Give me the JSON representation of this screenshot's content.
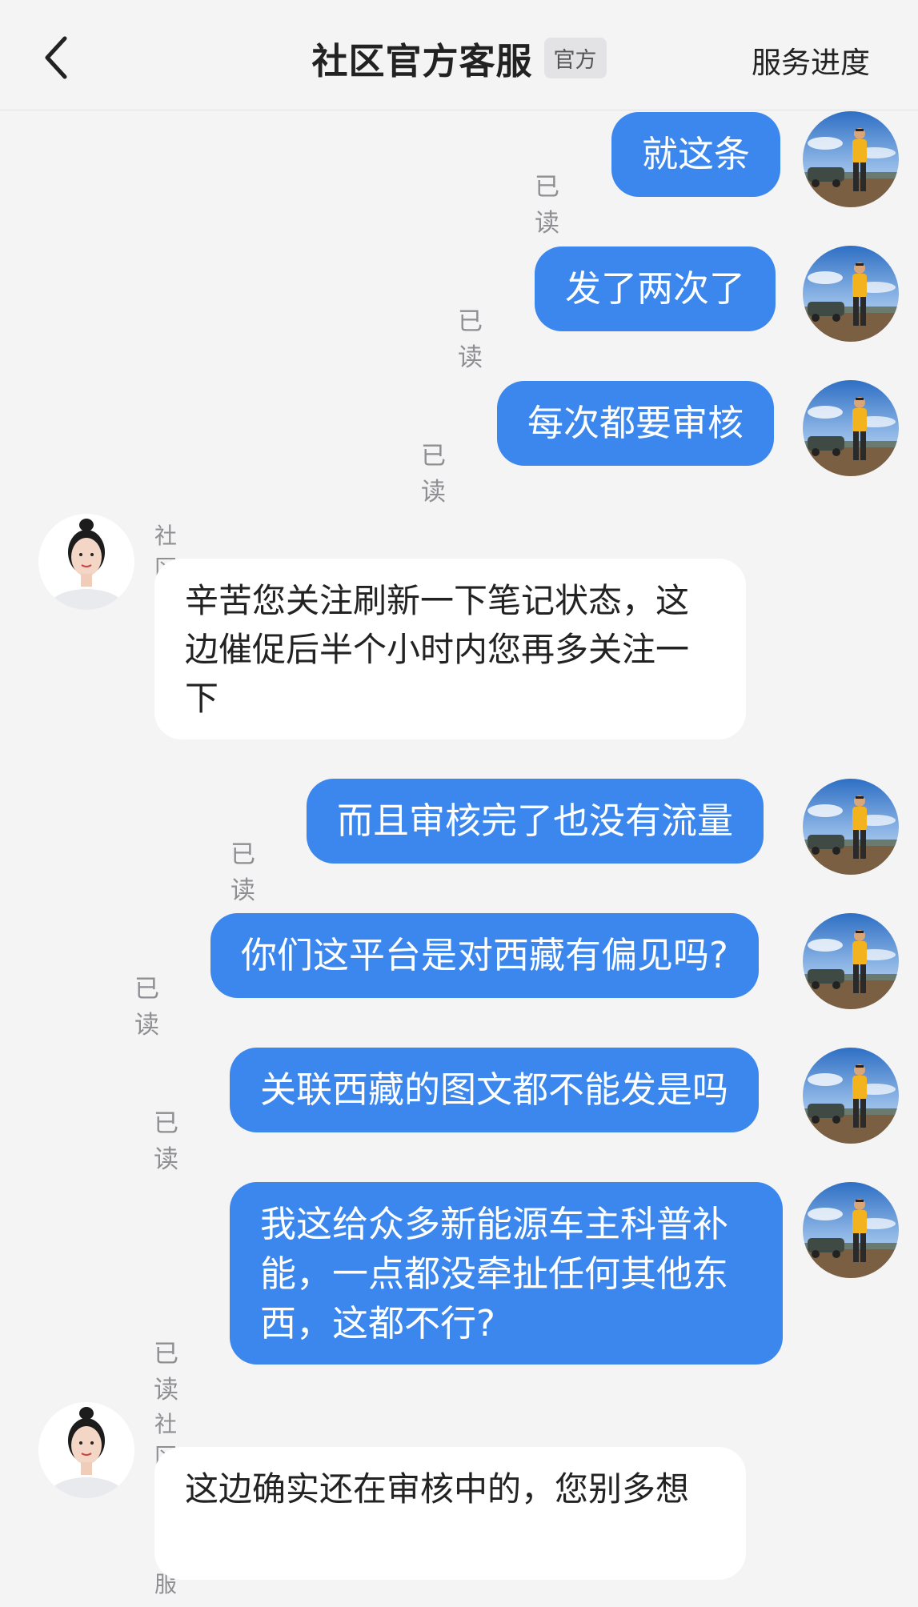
{
  "header": {
    "title": "社区官方客服",
    "badge": "官方",
    "service_progress": "服务进度"
  },
  "messages": [
    {
      "side": "out",
      "text": "就这条",
      "status": "已读"
    },
    {
      "side": "out",
      "text": "发了两次了",
      "status": "已读"
    },
    {
      "side": "out",
      "text": "每次都要审核",
      "status": "已读"
    },
    {
      "side": "in",
      "sender": "社区官方客服",
      "text": "辛苦您关注刷新一下笔记状态，这边催促后半个小时内您再多关注一下"
    },
    {
      "side": "out",
      "text": "而且审核完了也没有流量",
      "status": "已读"
    },
    {
      "side": "out",
      "text": "你们这平台是对西藏有偏见吗?",
      "status": "已读"
    },
    {
      "side": "out",
      "text": "关联西藏的图文都不能发是吗",
      "status": "已读"
    },
    {
      "side": "out",
      "text": "我这给众多新能源车主科普补能，一点都没牵扯任何其他东西，这都不行?",
      "status": "已读"
    },
    {
      "side": "in",
      "sender": "社区官方客服",
      "text": "这边确实还在审核中的，您别多想"
    }
  ],
  "icons": {
    "back": "chevron-left-icon",
    "user_avatar": "user-avatar-photo",
    "agent_avatar": "agent-avatar-photo"
  },
  "colors": {
    "outgoing_bubble": "#3b87ee",
    "incoming_bubble": "#ffffff",
    "background": "#f4f4f5"
  }
}
